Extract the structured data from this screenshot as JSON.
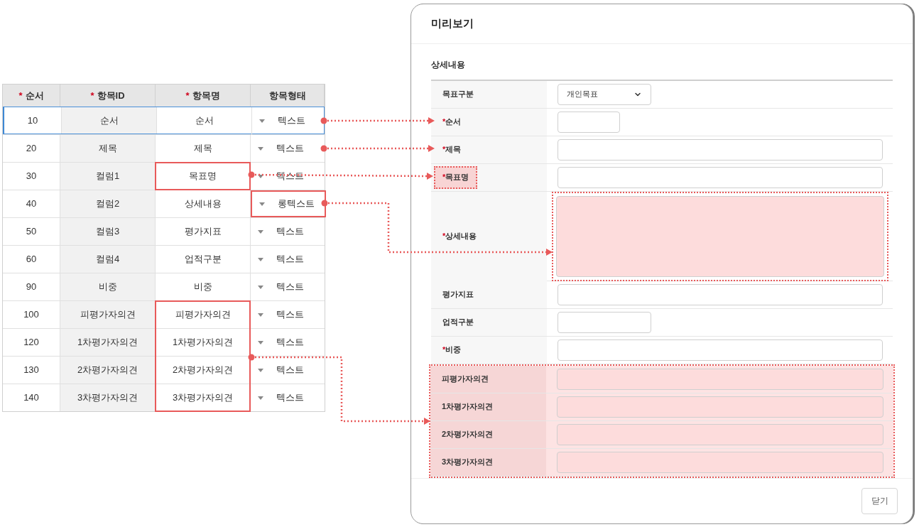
{
  "item_table": {
    "columns": [
      {
        "label": "순서",
        "required_mark": "*"
      },
      {
        "label": "항목ID",
        "required_mark": "*"
      },
      {
        "label": "항목명",
        "required_mark": "*"
      },
      {
        "label": "항목형태"
      }
    ],
    "rows": [
      {
        "order": "10",
        "id": "순서",
        "name": "순서",
        "type": "텍스트",
        "selected": true,
        "name_marked": false,
        "type_marked": false
      },
      {
        "order": "20",
        "id": "제목",
        "name": "제목",
        "type": "텍스트",
        "selected": false,
        "name_marked": false,
        "type_marked": false
      },
      {
        "order": "30",
        "id": "컬럼1",
        "name": "목표명",
        "type": "텍스트",
        "selected": false,
        "name_marked": true,
        "type_marked": false
      },
      {
        "order": "40",
        "id": "컬럼2",
        "name": "상세내용",
        "type": "롱텍스트",
        "selected": false,
        "name_marked": false,
        "type_marked": true
      },
      {
        "order": "50",
        "id": "컬럼3",
        "name": "평가지표",
        "type": "텍스트",
        "selected": false,
        "name_marked": false,
        "type_marked": false
      },
      {
        "order": "60",
        "id": "컬럼4",
        "name": "업적구분",
        "type": "텍스트",
        "selected": false,
        "name_marked": false,
        "type_marked": false
      },
      {
        "order": "90",
        "id": "비중",
        "name": "비중",
        "type": "텍스트",
        "selected": false,
        "name_marked": false,
        "type_marked": false
      },
      {
        "order": "100",
        "id": "피평가자의견",
        "name": "피평가자의견",
        "type": "텍스트",
        "selected": false,
        "name_marked": true,
        "type_marked": false
      },
      {
        "order": "120",
        "id": "1차평가자의견",
        "name": "1차평가자의견",
        "type": "텍스트",
        "selected": false,
        "name_marked": true,
        "type_marked": false
      },
      {
        "order": "130",
        "id": "2차평가자의견",
        "name": "2차평가자의견",
        "type": "텍스트",
        "selected": false,
        "name_marked": true,
        "type_marked": false
      },
      {
        "order": "140",
        "id": "3차평가자의견",
        "name": "3차평가자의견",
        "type": "텍스트",
        "selected": false,
        "name_marked": true,
        "type_marked": false
      }
    ]
  },
  "dialog": {
    "title": "미리보기",
    "section_title": "상세내용",
    "rows": [
      {
        "label": "목표구분",
        "kind": "select",
        "value": "개인목표",
        "label_marked": false,
        "field_marked": false,
        "row_marked": false
      },
      {
        "label": "순서",
        "required_mark": "*",
        "kind": "compact",
        "label_marked": false,
        "field_marked": false,
        "row_marked": false
      },
      {
        "label": "제목",
        "required_mark": "*",
        "kind": "input",
        "label_marked": false,
        "field_marked": false,
        "row_marked": false
      },
      {
        "label": "목표명",
        "required_mark": "*",
        "kind": "input",
        "label_marked": true,
        "field_marked": false,
        "row_marked": false
      },
      {
        "label": "상세내용",
        "required_mark": "*",
        "kind": "textarea",
        "label_marked": false,
        "field_marked": true,
        "row_marked": false
      },
      {
        "label": "평가지표",
        "kind": "input",
        "label_marked": false,
        "field_marked": false,
        "row_marked": false
      },
      {
        "label": "업적구분",
        "kind": "narrow",
        "label_marked": false,
        "field_marked": false,
        "row_marked": false
      },
      {
        "label": "비중",
        "required_mark": "*",
        "kind": "input",
        "label_marked": false,
        "field_marked": false,
        "row_marked": false
      },
      {
        "label": "피평가자의견",
        "kind": "input",
        "label_marked": false,
        "field_marked": false,
        "row_marked": true
      },
      {
        "label": "1차평가자의견",
        "kind": "input",
        "label_marked": false,
        "field_marked": false,
        "row_marked": true
      },
      {
        "label": "2차평가자의견",
        "kind": "input",
        "label_marked": false,
        "field_marked": false,
        "row_marked": true
      },
      {
        "label": "3차평가자의견",
        "kind": "input",
        "label_marked": false,
        "field_marked": false,
        "row_marked": true
      }
    ],
    "close_button": "닫기"
  }
}
